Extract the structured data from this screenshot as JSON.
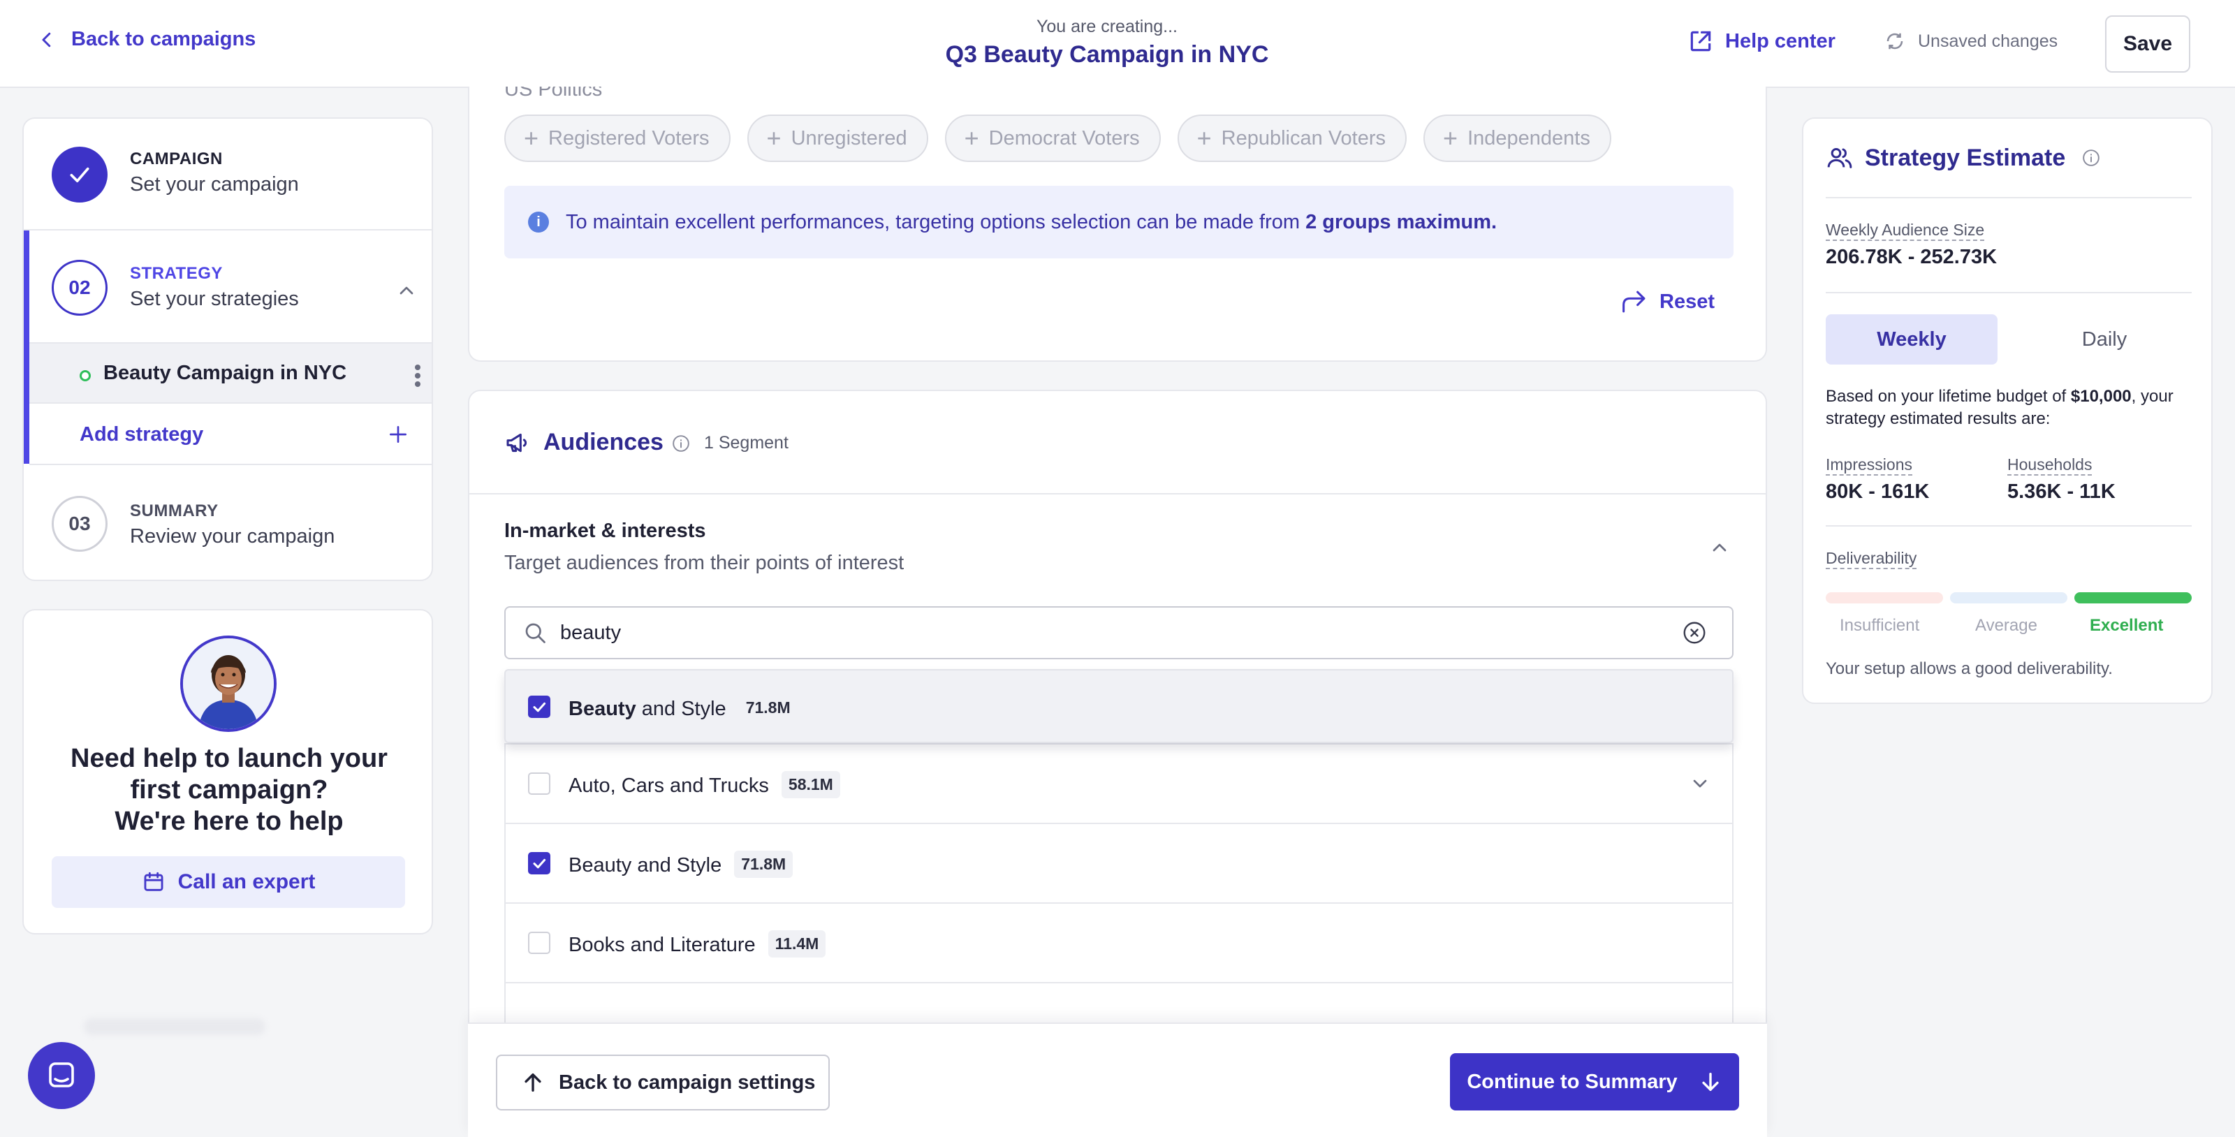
{
  "header": {
    "back_label": "Back to campaigns",
    "creating_label": "You are creating...",
    "campaign_title": "Q3 Beauty Campaign in NYC",
    "help_center_label": "Help center",
    "unsaved_label": "Unsaved changes",
    "save_label": "Save"
  },
  "stepper": {
    "step1": {
      "label": "CAMPAIGN",
      "desc": "Set your campaign"
    },
    "step2": {
      "number": "02",
      "label": "STRATEGY",
      "desc": "Set your strategies",
      "strategy_name": "Beauty Campaign in NYC",
      "add_label": "Add strategy"
    },
    "step3": {
      "number": "03",
      "label": "SUMMARY",
      "desc": "Review your campaign"
    }
  },
  "help_card": {
    "title_line1": "Need help to launch your",
    "title_line2": "first campaign?",
    "title_line3": "We're here to help",
    "cta_label": "Call an expert"
  },
  "targeting": {
    "group_title": "US Politics",
    "chips": [
      "Registered Voters",
      "Unregistered",
      "Democrat Voters",
      "Republican Voters",
      "Independents"
    ],
    "info_text": "To maintain excellent performances, targeting options selection can be made from ",
    "info_bold": "2 groups maximum.",
    "reset_label": "Reset"
  },
  "audiences": {
    "title": "Audiences",
    "segment_count": "1 Segment",
    "section_title": "In-market & interests",
    "section_subtitle": "Target audiences from their points of interest",
    "search_value": "beauty",
    "suggestion": {
      "match": "Beauty",
      "rest": " and Style",
      "size": "71.8M",
      "checked": true
    },
    "rows": [
      {
        "label": "Auto, Cars and Trucks",
        "size": "58.1M",
        "checked": false,
        "expandable": true
      },
      {
        "label": "Beauty and Style",
        "size": "71.8M",
        "checked": true,
        "expandable": false
      },
      {
        "label": "Books and Literature",
        "size": "11.4M",
        "checked": false,
        "expandable": false
      }
    ]
  },
  "actions": {
    "back_label": "Back to campaign settings",
    "continue_label": "Continue to Summary"
  },
  "estimate": {
    "title": "Strategy Estimate",
    "weekly_audience_label": "Weekly Audience Size",
    "weekly_audience_value": "206.78K - 252.73K",
    "toggle_weekly": "Weekly",
    "toggle_daily": "Daily",
    "budget_prefix": "Based on your lifetime budget of ",
    "budget_value": "$10,000",
    "budget_suffix": ", your strategy estimated results are:",
    "impressions_label": "Impressions",
    "impressions_value": "80K - 161K",
    "households_label": "Households",
    "households_value": "5.36K - 11K",
    "deliverability_label": "Deliverability",
    "levels": [
      "Insufficient",
      "Average",
      "Excellent"
    ],
    "active_level": "Excellent",
    "deliverability_note": "Your setup allows a good deliverability.",
    "colors": {
      "insufficient": "#fde8e6",
      "average": "#e4eefa",
      "excellent": "#3fbf5c"
    }
  },
  "colors": {
    "accent": "#4338ca",
    "primary_button": "#3d33c7",
    "success": "#2fbe5a"
  }
}
